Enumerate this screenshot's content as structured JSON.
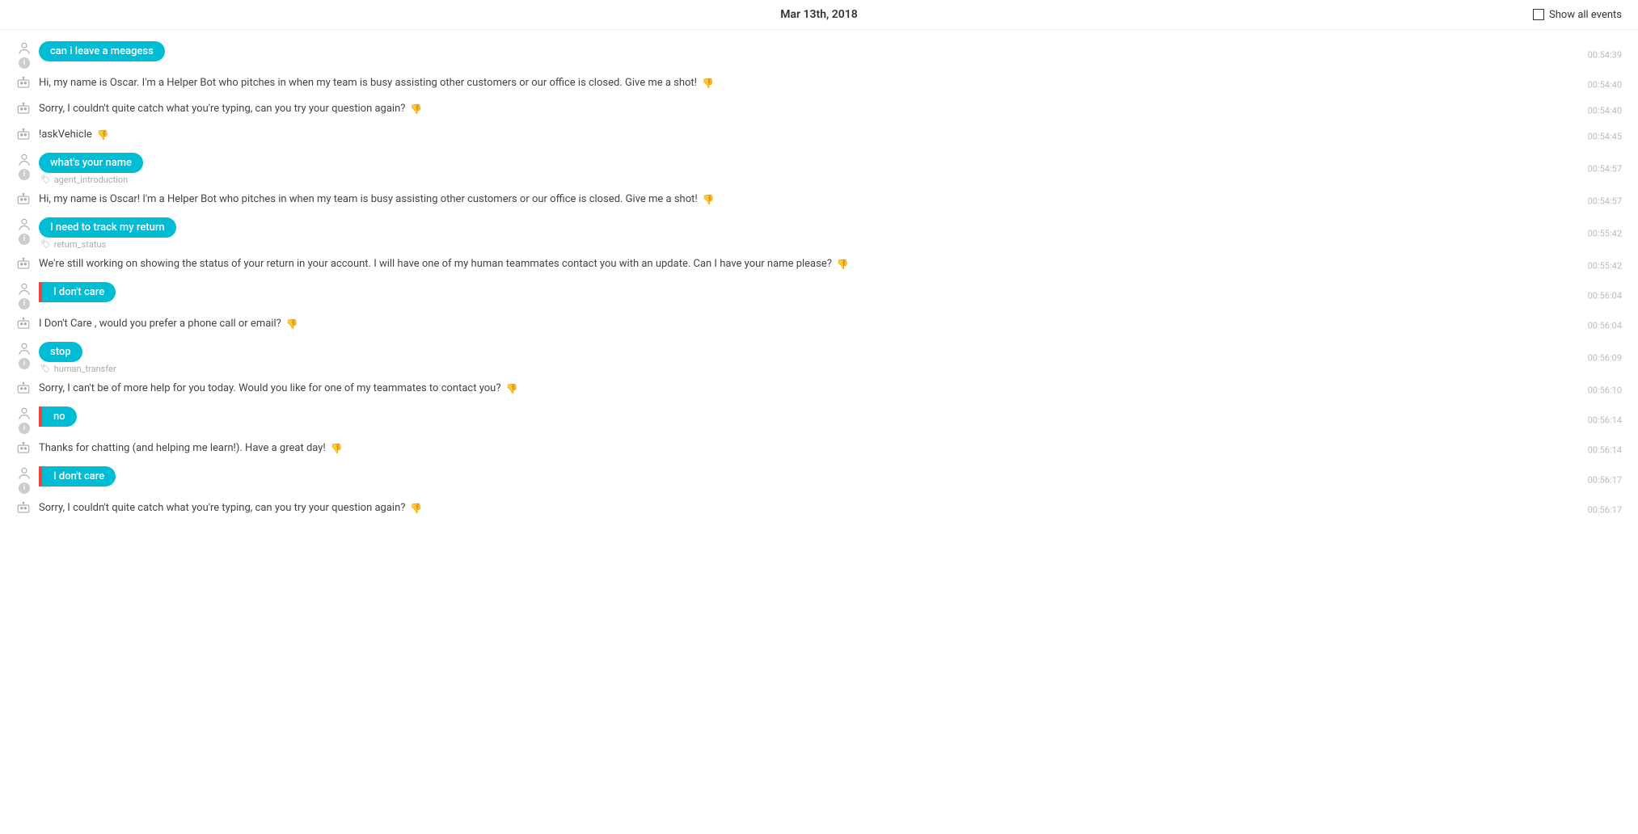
{
  "header": {
    "date": "Mar 13th, 2018",
    "show_all_label": "Show all events"
  },
  "messages": [
    {
      "id": 1,
      "type": "user",
      "text": "can i leave a meagess",
      "has_red_left": false,
      "tag": null,
      "timestamp": "00:54:39"
    },
    {
      "id": 2,
      "type": "bot",
      "text": "Hi, my name is Oscar. I'm a Helper Bot who pitches in when my team is busy assisting other customers or our office is closed. Give me a shot!",
      "timestamp": "00:54:40",
      "thumbs": true
    },
    {
      "id": 3,
      "type": "bot",
      "text": "Sorry, I couldn't quite catch what you're typing, can you try your question again?",
      "timestamp": "00:54:40",
      "thumbs": true
    },
    {
      "id": 4,
      "type": "bot",
      "text": "!askVehicle",
      "timestamp": "00:54:45",
      "thumbs": true
    },
    {
      "id": 5,
      "type": "user",
      "text": "what's your name",
      "has_red_left": false,
      "tag": "agent_introduction",
      "timestamp": "00:54:57"
    },
    {
      "id": 6,
      "type": "bot",
      "text": "Hi, my name is Oscar! I'm a Helper Bot who pitches in when my team is busy assisting other customers or our office is closed. Give me a shot!",
      "timestamp": "00:54:57",
      "thumbs": true
    },
    {
      "id": 7,
      "type": "user",
      "text": "I need to track my return",
      "has_red_left": false,
      "tag": "return_status",
      "timestamp": "00:55:42"
    },
    {
      "id": 8,
      "type": "bot",
      "text": "We're still working on showing the status of your return in your account. I will have one of my human teammates contact you with an update. Can I have your name please?",
      "timestamp": "00:55:42",
      "thumbs": true
    },
    {
      "id": 9,
      "type": "user",
      "text": "I don't care",
      "has_red_left": true,
      "tag": null,
      "timestamp": "00:56:04"
    },
    {
      "id": 10,
      "type": "bot",
      "text": "I Don't Care , would you prefer a phone call or email?",
      "timestamp": "00:56:04",
      "thumbs": true
    },
    {
      "id": 11,
      "type": "user",
      "text": "stop",
      "has_red_left": false,
      "tag": "human_transfer",
      "timestamp": "00:56:09"
    },
    {
      "id": 12,
      "type": "bot",
      "text": "Sorry, I can't be of more help for you today. Would you like for one of my teammates to contact you?",
      "timestamp": "00:56:10",
      "thumbs": true
    },
    {
      "id": 13,
      "type": "user",
      "text": "no",
      "has_red_left": true,
      "tag": null,
      "timestamp": "00:56:14"
    },
    {
      "id": 14,
      "type": "bot",
      "text": "Thanks for chatting (and helping me learn!). Have a great day!",
      "timestamp": "00:56:14",
      "thumbs": true
    },
    {
      "id": 15,
      "type": "user",
      "text": "I don't care",
      "has_red_left": true,
      "tag": null,
      "timestamp": "00:56:17"
    },
    {
      "id": 16,
      "type": "bot",
      "text": "Sorry, I couldn't quite catch what you're typing, can you try your question again?",
      "timestamp": "00:56:17",
      "thumbs": true
    }
  ]
}
